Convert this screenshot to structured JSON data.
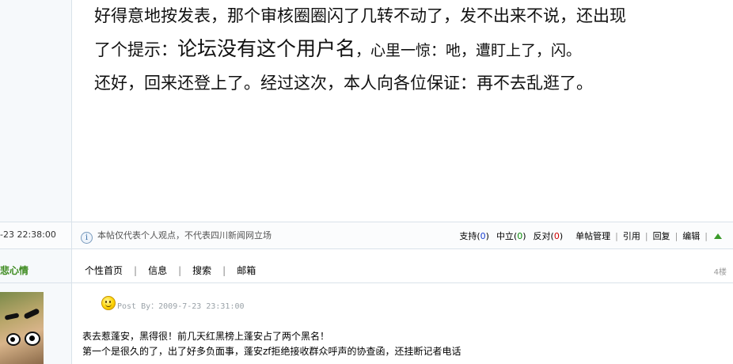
{
  "post3": {
    "lines": {
      "l1": "好得意地按发表，那个审核圈圈闪了几转不动了，发不出来不说，还出现",
      "l2a": "了个提示：",
      "l2b": "论坛没有这个用户名",
      "l2c": "，心里一惊：吔，遭盯上了，闪。",
      "l3": "还好，回来还登上了。经过这次，本人向各位保证：再不去乱逛了。"
    },
    "post_time": "-23 22:38:00",
    "disclaimer": "本帖仅代表个人观点，不代表四川新闻网立场",
    "actions": {
      "support_label": "支持",
      "support_count": "0",
      "neutral_label": "中立",
      "neutral_count": "0",
      "oppose_label": "反对",
      "oppose_count": "0",
      "manage": "单帖管理",
      "quote": "引用",
      "reply": "回复",
      "edit": "编辑"
    }
  },
  "post4": {
    "author": "悲心情",
    "nav": {
      "home": "个性首页",
      "info": "信息",
      "search": "搜索",
      "mail": "邮箱"
    },
    "floor": "4楼",
    "post_by": "Post By：2009-7-23 23:31:00",
    "content": {
      "line1": "表去惹蓬安，黑得很！前几天红黑榜上蓬安占了两个黑名！",
      "line2": "第一个是很久的了，出了好多负面事，蓬安zf拒绝接收群众呼声的协查函，还挂断记者电话"
    }
  },
  "colors": {
    "support": "#1a3fd1",
    "neutral": "#0a8a0a",
    "oppose": "#d00000",
    "author": "#3c8a1e"
  }
}
